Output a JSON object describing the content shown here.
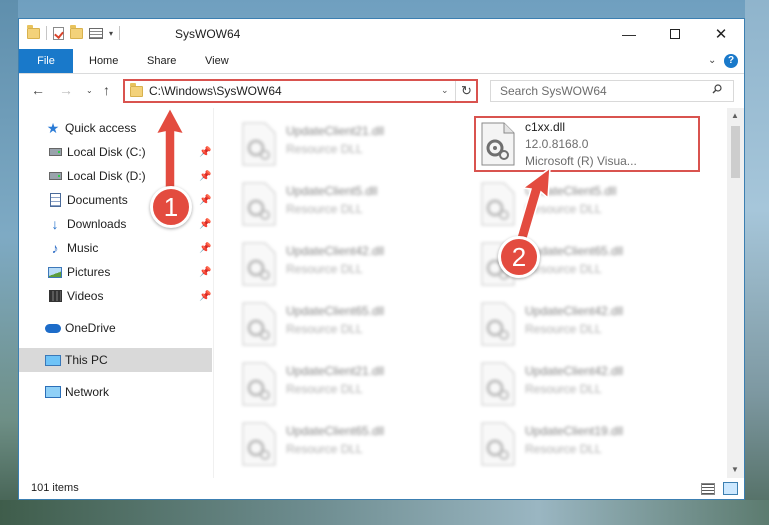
{
  "window": {
    "title": "SysWOW64",
    "minimize": "—",
    "close": "✕"
  },
  "ribbon": {
    "tabs": [
      "File",
      "Home",
      "Share",
      "View"
    ],
    "chevron": "⌄",
    "help": "?"
  },
  "nav": {
    "address": "C:\\Windows\\SysWOW64",
    "search_placeholder": "Search SysWOW64",
    "back": "←",
    "forward": "→",
    "recent": "⌄",
    "up": "↑",
    "refresh": "↻",
    "address_dropdown": "⌄"
  },
  "sidebar": {
    "items": [
      {
        "label": "Quick access"
      },
      {
        "label": "Local Disk (C:)"
      },
      {
        "label": "Local Disk (D:)"
      },
      {
        "label": "Documents"
      },
      {
        "label": "Downloads"
      },
      {
        "label": "Music"
      },
      {
        "label": "Pictures"
      },
      {
        "label": "Videos"
      },
      {
        "label": "OneDrive"
      },
      {
        "label": "This PC"
      },
      {
        "label": "Network"
      }
    ]
  },
  "files": {
    "highlighted": {
      "name": "c1xx.dll",
      "version": "12.0.8168.0",
      "description": "Microsoft (R) Visua..."
    },
    "left_column": [
      {
        "name": "UpdateClient21.dll",
        "type": "Resource DLL"
      },
      {
        "name": "UpdateClient5.dll",
        "type": "Resource DLL"
      },
      {
        "name": "UpdateClient42.dll",
        "type": "Resource DLL"
      },
      {
        "name": "UpdateClient65.dll",
        "type": "Resource DLL"
      },
      {
        "name": "UpdateClient21.dll",
        "type": "Resource DLL"
      },
      {
        "name": "UpdateClient65.dll",
        "type": "Resource DLL"
      }
    ],
    "right_column": [
      {
        "name": "UpdateClient5.dll",
        "type": "Resource DLL"
      },
      {
        "name": "UpdateClient65.dll",
        "type": "Resource DLL"
      },
      {
        "name": "UpdateClient42.dll",
        "type": "Resource DLL"
      },
      {
        "name": "UpdateClient42.dll",
        "type": "Resource DLL"
      },
      {
        "name": "UpdateClient19.dll",
        "type": "Resource DLL"
      }
    ]
  },
  "status": {
    "item_count": "101 items"
  },
  "annotations": {
    "step1": "1",
    "step2": "2",
    "color": "#e34b3f"
  }
}
